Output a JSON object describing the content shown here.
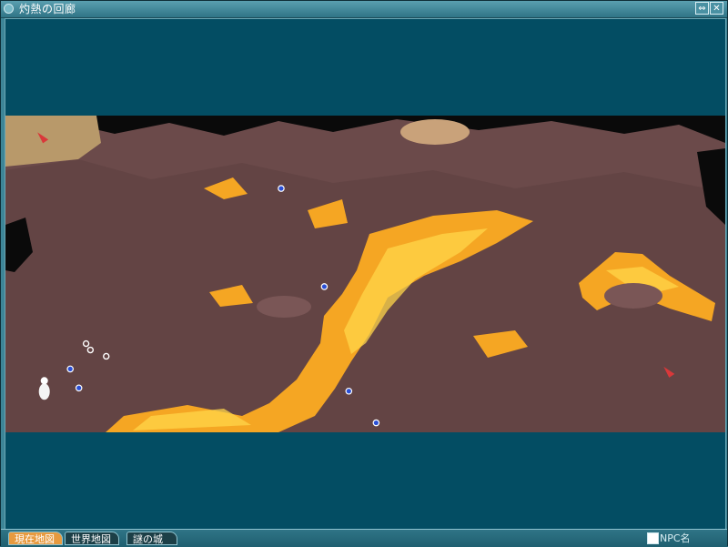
{
  "window": {
    "title": "灼熱の回廊",
    "pin_glyph": "⇔",
    "close_glyph": "✕"
  },
  "tabs": [
    {
      "label": "現在地図",
      "active": true
    },
    {
      "label": "世界地図",
      "active": false
    },
    {
      "label": "謎の城",
      "active": false
    }
  ],
  "npc_toggle": {
    "label": "NPC名",
    "checked": false
  },
  "colors": {
    "background": "#034d63",
    "rock": "#6b4a4a",
    "lava": "#f5a623",
    "lava_core": "#ffd54a",
    "accent_tab": "#e79a3f"
  },
  "markers": [
    {
      "kind": "portal-dot",
      "pos": [
        0.383,
        0.23
      ]
    },
    {
      "kind": "portal-dot",
      "pos": [
        0.443,
        0.54
      ]
    },
    {
      "kind": "portal-dot",
      "pos": [
        0.09,
        0.8
      ]
    },
    {
      "kind": "portal-dot",
      "pos": [
        0.102,
        0.86
      ]
    },
    {
      "kind": "portal-dot",
      "pos": [
        0.477,
        0.87
      ]
    },
    {
      "kind": "portal-dot",
      "pos": [
        0.515,
        0.97
      ]
    },
    {
      "kind": "waypoint-dot",
      "pos": [
        0.112,
        0.72
      ]
    },
    {
      "kind": "waypoint-dot",
      "pos": [
        0.118,
        0.74
      ]
    },
    {
      "kind": "waypoint-dot",
      "pos": [
        0.14,
        0.76
      ]
    },
    {
      "kind": "player-icon",
      "pos": [
        0.054,
        0.86
      ]
    },
    {
      "kind": "arrow-icon",
      "pos": [
        0.052,
        0.07
      ]
    },
    {
      "kind": "arrow-icon",
      "pos": [
        0.922,
        0.81
      ]
    }
  ]
}
